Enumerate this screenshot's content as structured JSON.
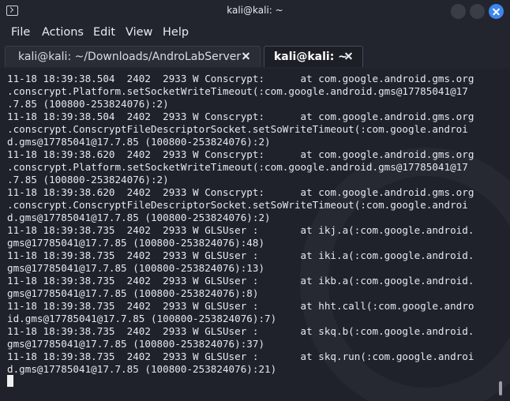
{
  "window": {
    "title": "kali@kali: ~"
  },
  "menu": [
    "File",
    "Actions",
    "Edit",
    "View",
    "Help"
  ],
  "tabs": [
    {
      "label": "kali@kali: ~/Downloads/AndroLabServer",
      "active": false
    },
    {
      "label": "kali@kali: ~",
      "active": true
    }
  ],
  "terminal": {
    "lines": [
      "11-18 18:39:38.504  2402  2933 W Conscrypt:      at com.google.android.gms.org",
      ".conscrypt.Platform.setSocketWriteTimeout(:com.google.android.gms@17785041@17",
      ".7.85 (100800-253824076):2)",
      "11-18 18:39:38.504  2402  2933 W Conscrypt:      at com.google.android.gms.org",
      ".conscrypt.ConscryptFileDescriptorSocket.setSoWriteTimeout(:com.google.androi",
      "d.gms@17785041@17.7.85 (100800-253824076):2)",
      "11-18 18:39:38.620  2402  2933 W Conscrypt:      at com.google.android.gms.org",
      ".conscrypt.Platform.setSocketWriteTimeout(:com.google.android.gms@17785041@17",
      ".7.85 (100800-253824076):2)",
      "11-18 18:39:38.620  2402  2933 W Conscrypt:      at com.google.android.gms.org",
      ".conscrypt.ConscryptFileDescriptorSocket.setSoWriteTimeout(:com.google.androi",
      "d.gms@17785041@17.7.85 (100800-253824076):2)",
      "11-18 18:39:38.735  2402  2933 W GLSUser :       at ikj.a(:com.google.android.",
      "gms@17785041@17.7.85 (100800-253824076):48)",
      "11-18 18:39:38.735  2402  2933 W GLSUser :       at iki.a(:com.google.android.",
      "gms@17785041@17.7.85 (100800-253824076):13)",
      "11-18 18:39:38.735  2402  2933 W GLSUser :       at ikb.a(:com.google.android.",
      "gms@17785041@17.7.85 (100800-253824076):8)",
      "11-18 18:39:38.735  2402  2933 W GLSUser :       at hht.call(:com.google.andro",
      "id.gms@17785041@17.7.85 (100800-253824076):7)",
      "11-18 18:39:38.735  2402  2933 W GLSUser :       at skq.b(:com.google.android.",
      "gms@17785041@17.7.85 (100800-253824076):37)",
      "11-18 18:39:38.735  2402  2933 W GLSUser :       at skq.run(:com.google.androi",
      "d.gms@17785041@17.7.85 (100800-253824076):21)"
    ]
  }
}
